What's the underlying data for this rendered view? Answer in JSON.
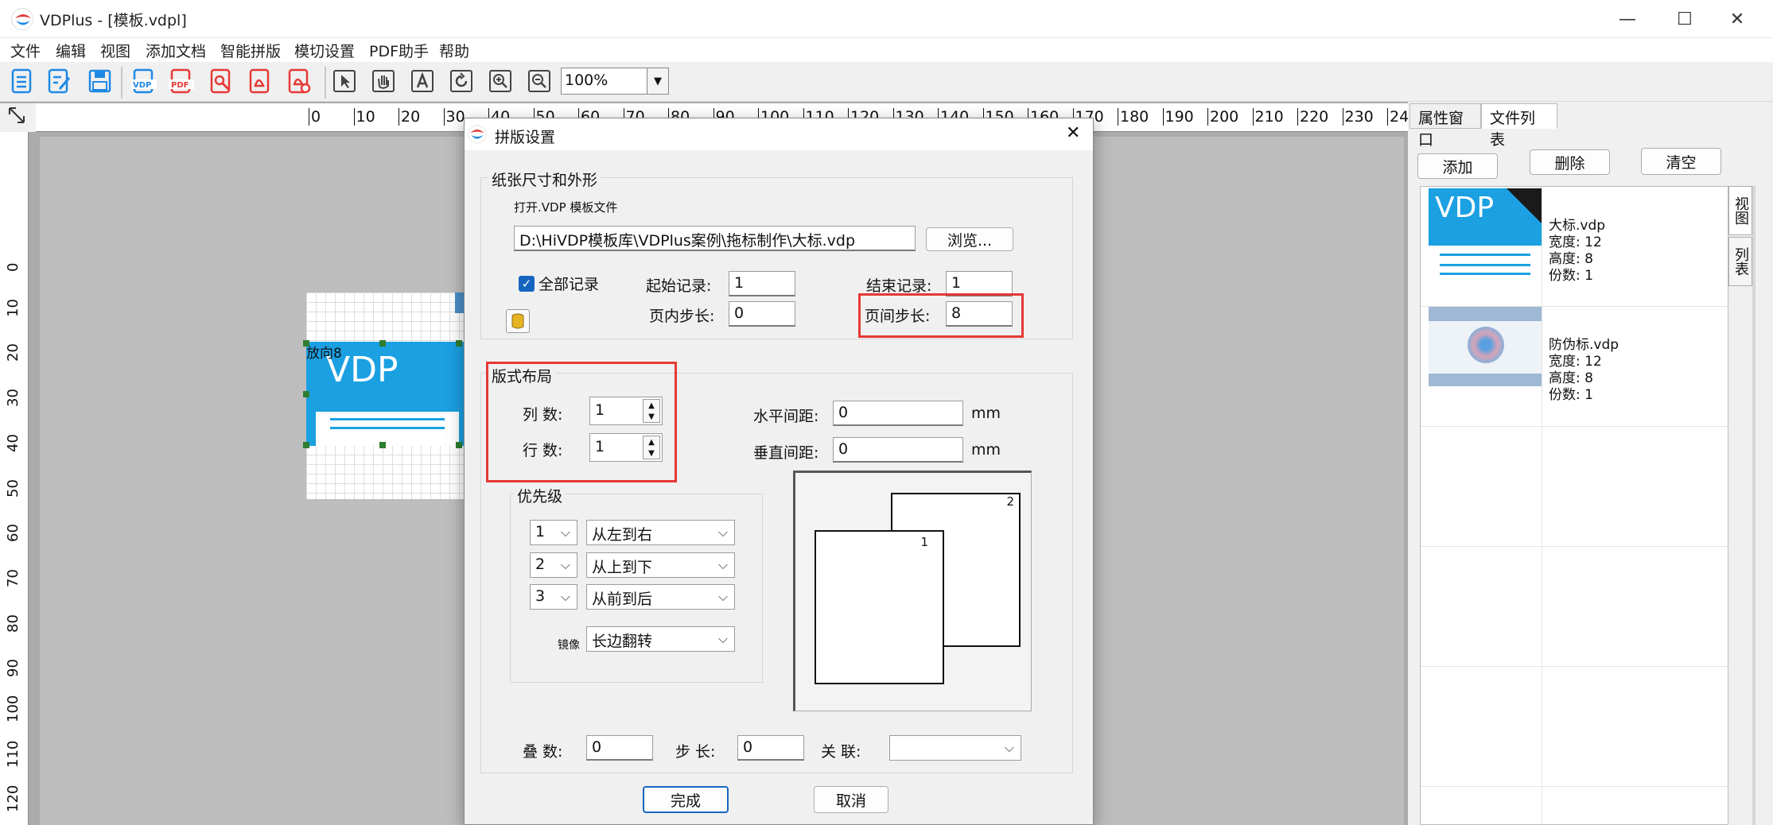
{
  "window": {
    "title": "VDPlus - [模板.vdpl]",
    "minimize": "—",
    "maximize": "☐",
    "close": "✕"
  },
  "menu": [
    "文件",
    "编辑",
    "视图",
    "添加文档",
    "智能拼版",
    "模切设置",
    "PDF助手",
    "帮助"
  ],
  "toolbar": {
    "icons": [
      "new-doc-icon",
      "edit-doc-icon",
      "save-icon",
      "vdp-icon",
      "pdf-icon",
      "pdf-search-icon",
      "pdf-export-icon",
      "pdf-settings-icon",
      "pointer-icon",
      "hand-icon",
      "text-tool-icon",
      "rotate-icon",
      "zoom-in-icon",
      "zoom-out-icon"
    ],
    "zoom": "100%"
  },
  "ruler_h": [
    "0",
    "10",
    "20",
    "30",
    "40",
    "50",
    "60",
    "70",
    "80",
    "90",
    "100",
    "110",
    "120",
    "130",
    "140",
    "150",
    "160",
    "170",
    "180",
    "190",
    "200",
    "210",
    "220",
    "230",
    "24"
  ],
  "ruler_v": [
    "0",
    "10",
    "20",
    "30",
    "40",
    "50",
    "60",
    "70",
    "80",
    "90",
    "100",
    "110",
    "120"
  ],
  "canvas": {
    "element_label": "放向8",
    "element_logo": "VDP"
  },
  "right_panel": {
    "tabs": [
      "属性窗口",
      "文件列表"
    ],
    "buttons": {
      "add": "添加",
      "delete": "删除",
      "clear": "清空"
    },
    "side_tabs": [
      "视图",
      "列表"
    ],
    "files": [
      {
        "name": "大标.vdp",
        "width": "宽度: 12",
        "height": "高度: 8",
        "copies": "份数: 1",
        "thumb": "VDP"
      },
      {
        "name": "防伪标.vdp",
        "width": "宽度: 12",
        "height": "高度: 8",
        "copies": "份数: 1"
      }
    ]
  },
  "dialog": {
    "title": "拼版设置",
    "close": "✕",
    "paper_group": "纸张尺寸和外形",
    "open_label": "打开.VDP 模板文件",
    "path": "D:\\HiVDP模板库\\VDPlus案例\\拖标制作\\大标.vdp",
    "browse": "浏览...",
    "all_records": "全部记录",
    "start_record_label": "起始记录:",
    "start_record": "1",
    "end_record_label": "结束记录:",
    "end_record": "1",
    "inner_step_label": "页内步长:",
    "inner_step": "0",
    "page_step_label": "页间步长:",
    "page_step": "8",
    "layout_group": "版式布局",
    "columns_label": "列  数:",
    "columns": "1",
    "rows_label": "行  数:",
    "rows": "1",
    "h_gap_label": "水平间距:",
    "h_gap": "0",
    "v_gap_label": "垂直间距:",
    "v_gap": "0",
    "unit": "mm",
    "priority_group": "优先级",
    "priorities": [
      {
        "num": "1",
        "dir": "从左到右"
      },
      {
        "num": "2",
        "dir": "从上到下"
      },
      {
        "num": "3",
        "dir": "从前到后"
      }
    ],
    "mirror_label": "镜像",
    "mirror": "长边翻转",
    "preview_labels": [
      "2",
      "1"
    ],
    "stack_label": "叠  数:",
    "stack": "0",
    "step_label": "步  长:",
    "step": "0",
    "link_label": "关  联:",
    "link": "",
    "ok": "完成",
    "cancel": "取消"
  }
}
